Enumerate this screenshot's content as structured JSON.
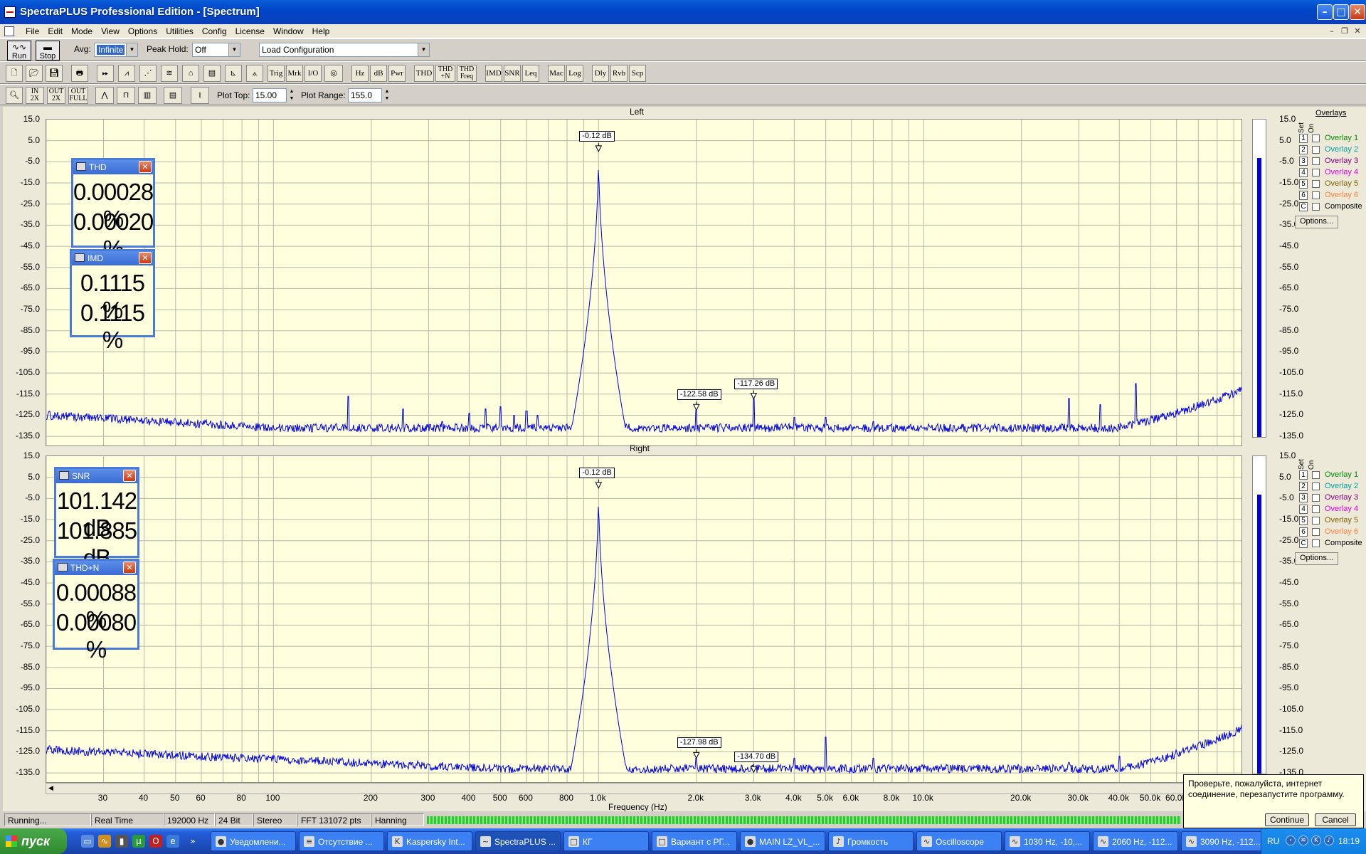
{
  "window": {
    "title": "SpectraPLUS Professional Edition - [Spectrum]",
    "minimize": "–",
    "maximize": "□",
    "close": "✕"
  },
  "menu": [
    "File",
    "Edit",
    "Mode",
    "View",
    "Options",
    "Utilities",
    "Config",
    "License",
    "Window",
    "Help"
  ],
  "mdi_controls": [
    "–",
    "❐",
    "✕"
  ],
  "toolbar1": {
    "run": "Run",
    "stop": "Stop",
    "avg_label": "Avg:",
    "avg_value": "Infinite",
    "peak_hold_label": "Peak Hold:",
    "peak_hold_value": "Off",
    "config_value": "Load Configuration"
  },
  "toolbar2": {
    "file_icons": [
      "new-file-icon",
      "open-icon",
      "save-icon",
      "print-icon"
    ],
    "mode_icons": [
      "forward-icon",
      "spectrum-icon",
      "wave-icon",
      "waterfall-icon",
      "3d-icon",
      "table-icon",
      "axes-icon",
      "tripod-icon"
    ],
    "buttons": [
      "Trig",
      "Mrk",
      "I/O"
    ],
    "units": [
      "Hz",
      "dB",
      "Pwr"
    ],
    "measure": [
      "THD",
      "THD +N",
      "THD Freq"
    ],
    "analysis": [
      "IMD",
      "SNR",
      "Leq"
    ],
    "misc": [
      "Mac",
      "Log"
    ],
    "delay": [
      "Dly",
      "Rvb",
      "Scp"
    ]
  },
  "toolbar3": {
    "zoom_buttons": [
      "IN 2X",
      "OUT 2X",
      "OUT FULL"
    ],
    "plot_top_label": "Plot Top:",
    "plot_top_value": "15.00",
    "plot_range_label": "Plot Range:",
    "plot_range_value": "155.0"
  },
  "y_ticks": [
    "15.0",
    "5.0",
    "-5.0",
    "-15.0",
    "-25.0",
    "-35.0",
    "-45.0",
    "-55.0",
    "-65.0",
    "-75.0",
    "-85.0",
    "-95.0",
    "-105.0",
    "-115.0",
    "-125.0",
    "-135.0"
  ],
  "x_ticks": [
    "30",
    "40",
    "50",
    "60",
    "80",
    "100",
    "200",
    "300",
    "400",
    "500",
    "600",
    "800",
    "1.0k",
    "2.0k",
    "3.0k",
    "4.0k",
    "5.0k",
    "6.0k",
    "8.0k",
    "10.0k",
    "20.0k",
    "30.0k",
    "40.0k",
    "50.0k",
    "60.0k"
  ],
  "x_axis_label": "Frequency (Hz)",
  "overlays": {
    "header": "Overlays",
    "set_label": "Set",
    "on_label": "On",
    "items": [
      {
        "num": "1",
        "label": "Overlay 1",
        "color": "#008800"
      },
      {
        "num": "2",
        "label": "Overlay 2",
        "color": "#00a0a0"
      },
      {
        "num": "3",
        "label": "Overlay 3",
        "color": "#800080"
      },
      {
        "num": "4",
        "label": "Overlay 4",
        "color": "#e000e0"
      },
      {
        "num": "5",
        "label": "Overlay 5",
        "color": "#806000"
      },
      {
        "num": "6",
        "label": "Overlay 6",
        "color": "#ff8040"
      },
      {
        "num": "C",
        "label": "Composite",
        "color": "#000000"
      }
    ],
    "options_button": "Options..."
  },
  "left": {
    "title": "Left",
    "level_fraction": 0.88,
    "markers": [
      {
        "label": "-0.12 dB",
        "freq": 1000,
        "db": -0.12
      },
      {
        "label": "-122.58 dB",
        "freq": 2000,
        "db": -122.58
      },
      {
        "label": "-117.26 dB",
        "freq": 3000,
        "db": -117.26
      }
    ],
    "windows": [
      {
        "name": "THD",
        "v1": "0.00028 %",
        "v2": "0.00020 %"
      },
      {
        "name": "IMD",
        "v1": "0.1115 %",
        "v2": "0.1115 %"
      }
    ]
  },
  "right": {
    "title": "Right",
    "level_fraction": 0.88,
    "markers": [
      {
        "label": "-0.12 dB",
        "freq": 1000,
        "db": -0.12
      },
      {
        "label": "-127.98 dB",
        "freq": 2000,
        "db": -127.98
      },
      {
        "label": "-134.70 dB",
        "freq": 3000,
        "db": -134.7
      }
    ],
    "windows": [
      {
        "name": "SNR",
        "v1": "101.142 dB",
        "v2": "101.885 dB"
      },
      {
        "name": "THD+N",
        "v1": "0.00088 %",
        "v2": "0.00080 %"
      }
    ]
  },
  "chart_data": {
    "type": "line",
    "xlabel": "Frequency (Hz)",
    "x_scale": "log",
    "xlim": [
      20,
      96000
    ],
    "ylim": [
      -140,
      15
    ],
    "series": [
      {
        "name": "Left",
        "color": "#0000e0",
        "noise_floor_db": -131,
        "fundamental": {
          "freq": 1000,
          "db": -0.12
        },
        "spurs": [
          [
            170,
            -116
          ],
          [
            250,
            -122
          ],
          [
            330,
            -128
          ],
          [
            400,
            -124
          ],
          [
            450,
            -122
          ],
          [
            500,
            -121
          ],
          [
            550,
            -125
          ],
          [
            600,
            -123
          ],
          [
            650,
            -125
          ],
          [
            900,
            -122
          ],
          [
            2000,
            -122.58
          ],
          [
            3000,
            -117.26
          ],
          [
            4000,
            -126
          ],
          [
            5000,
            -126
          ],
          [
            7000,
            -128
          ],
          [
            28000,
            -117
          ],
          [
            35000,
            -120
          ],
          [
            45000,
            -110
          ]
        ],
        "hf_rise": {
          "start_freq": 38000,
          "end_db": -113
        }
      },
      {
        "name": "Right",
        "color": "#0000e0",
        "noise_floor_db": -133,
        "fundamental": {
          "freq": 1000,
          "db": -0.12
        },
        "spurs": [
          [
            2000,
            -127.98
          ],
          [
            3000,
            -134.7
          ],
          [
            5000,
            -118
          ],
          [
            4000,
            -128
          ],
          [
            7000,
            -128
          ],
          [
            28000,
            -130
          ],
          [
            40000,
            -127
          ]
        ],
        "hf_rise": {
          "start_freq": 40000,
          "end_db": -114
        },
        "lf_level": -124
      }
    ]
  },
  "status": {
    "state": "Running...",
    "mode": "Real Time",
    "rate": "192000 Hz",
    "bits": "24 Bit",
    "channels": "Stereo",
    "fft": "FFT 131072 pts",
    "window": "Hanning"
  },
  "popup": {
    "message": "Проверьте, пожалуйста, интернет соединение, перезапустите программу.",
    "continue": "Continue",
    "cancel": "Cancel"
  },
  "taskbar": {
    "start": "пуск",
    "tasks": [
      {
        "label": "Уведомлени...",
        "icon": "●"
      },
      {
        "label": "Отсутствие ...",
        "icon": "≡"
      },
      {
        "label": "Kaspersky Int...",
        "icon": "K"
      },
      {
        "label": "SpectraPLUS ...",
        "icon": "~",
        "active": true
      },
      {
        "label": "КГ",
        "icon": "□"
      },
      {
        "label": "Вариант с РГ...",
        "icon": "□"
      },
      {
        "label": "MAIN LZ_VL_...",
        "icon": "●"
      },
      {
        "label": "Громкость",
        "icon": "♪"
      },
      {
        "label": "Oscilloscope",
        "icon": "∿"
      },
      {
        "label": "1030 Hz, -10,...",
        "icon": "∿"
      },
      {
        "label": "2060 Hz, -112...",
        "icon": "∿"
      },
      {
        "label": "3090 Hz, -112...",
        "icon": "∿"
      }
    ],
    "lang": "RU",
    "time": "18:19"
  }
}
